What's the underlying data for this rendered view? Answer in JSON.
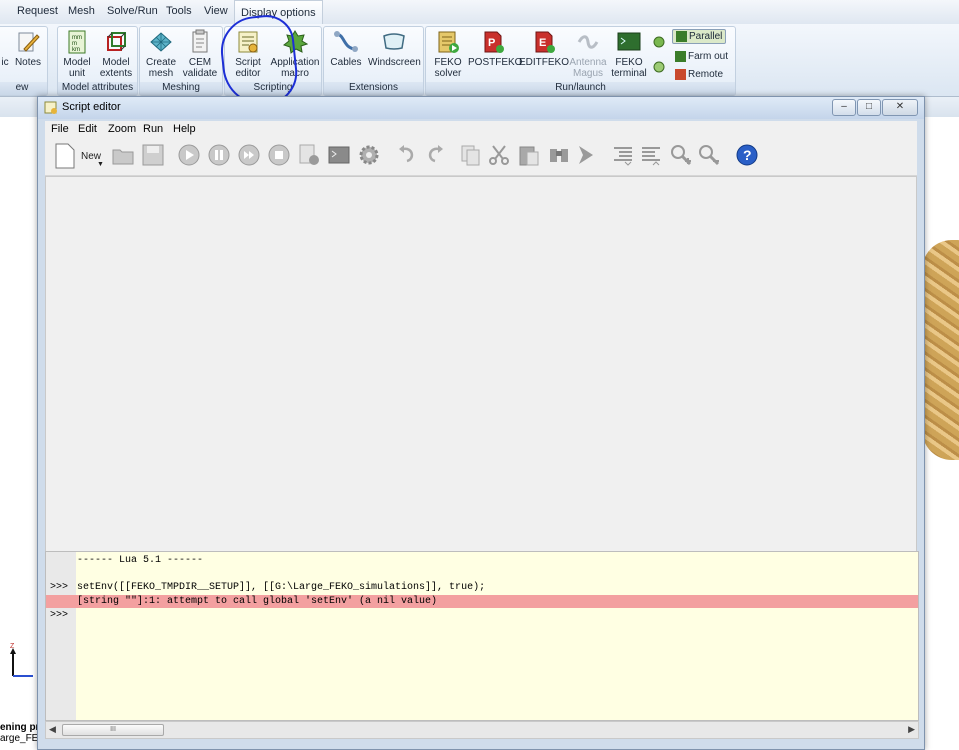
{
  "menubar": {
    "items": [
      "Request",
      "Mesh",
      "Solve/Run",
      "Tools",
      "View",
      "Display options"
    ]
  },
  "ribbon": {
    "groups": [
      {
        "label": "ew"
      },
      {
        "label": "Model attributes"
      },
      {
        "label": "Meshing"
      },
      {
        "label": "Scripting"
      },
      {
        "label": "Extensions"
      },
      {
        "label": "Run/launch"
      }
    ],
    "buttons": {
      "ic": "ic",
      "notes": "Notes",
      "model_unit": "Model\nunit",
      "model_extents": "Model\nextents",
      "create_mesh": "Create\nmesh",
      "cem_validate": "CEM\nvalidate",
      "script_editor": "Script\neditor",
      "application_macro": "Application\nmacro",
      "cables": "Cables",
      "windscreen": "Windscreen",
      "feko_solver": "FEKO\nsolver",
      "postfeko": "POSTFEKO",
      "editfeko": "EDITFEKO",
      "antenna_magus": "Antenna\nMagus",
      "feko_terminal": "FEKO\nterminal",
      "parallel": "Parallel",
      "farm_out": "Farm out",
      "remote": "Remote"
    }
  },
  "script_editor": {
    "title": "Script editor",
    "menu": [
      "File",
      "Edit",
      "Zoom",
      "Run",
      "Help"
    ],
    "new_label": "New",
    "console": {
      "header": "------ Lua 5.1 ------",
      "prompt": ">>>",
      "command": "setEnv([[FEKO_TMPDIR__SETUP]], [[G:\\Large_FEKO_simulations]], true);",
      "error": "[string \"\"]:1: attempt to call global 'setEnv' (a nil value)",
      "prompt2": ">>>"
    },
    "scroll_thumb": "III"
  },
  "background": {
    "status_line1": "ening pr",
    "status_line2": "arge_FEK",
    "axis_label": "Z"
  }
}
